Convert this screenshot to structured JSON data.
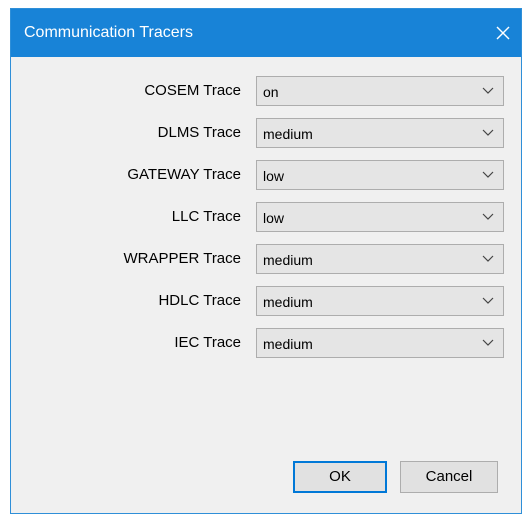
{
  "window": {
    "title": "Communication Tracers"
  },
  "icons": {
    "close": "close-icon",
    "dropdown_arrow": "chevron-down-icon"
  },
  "colors": {
    "titlebar": "#1883d7",
    "window_bg": "#f0f0f0",
    "default_button_border": "#0078d7"
  },
  "traces": [
    {
      "label": "COSEM Trace",
      "value": "on"
    },
    {
      "label": "DLMS Trace",
      "value": "medium"
    },
    {
      "label": "GATEWAY Trace",
      "value": "low"
    },
    {
      "label": "LLC Trace",
      "value": "low"
    },
    {
      "label": "WRAPPER Trace",
      "value": "medium"
    },
    {
      "label": "HDLC Trace",
      "value": "medium"
    },
    {
      "label": "IEC Trace",
      "value": "medium"
    }
  ],
  "buttons": {
    "ok_label": "OK",
    "cancel_label": "Cancel"
  }
}
